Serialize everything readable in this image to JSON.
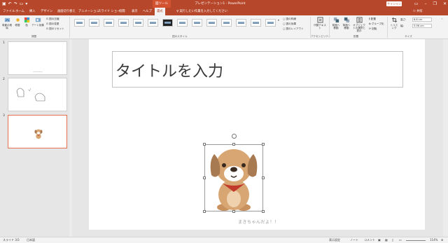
{
  "titlebar": {
    "context_tab": "図ツール",
    "document_title": "プレゼンテーション1 - PowerPoint",
    "signin": "サインイン"
  },
  "tabs": [
    "ファイル",
    "ホーム",
    "挿入",
    "デザイン",
    "画面切り替え",
    "アニメーション",
    "スライド ショー",
    "校閲",
    "表示",
    "ヘルプ",
    "書式"
  ],
  "tellme": "実行したい作業を入力してください",
  "share": "共有",
  "ribbon": {
    "adjust": {
      "label": "調整",
      "remove_bg": "背景の削除",
      "corrections": "修整",
      "color": "色",
      "art_effects": "アート効果",
      "compress": "図の圧縮",
      "change": "図の変更",
      "reset": "図のリセット"
    },
    "styles": {
      "label": "図のスタイル"
    },
    "style_options": {
      "border": "図の枠線",
      "effects": "図の効果",
      "layout": "図のレイアウト"
    },
    "accessibility": {
      "label": "アクセシビリティ",
      "alt_text": "代替テキスト"
    },
    "arrange": {
      "label": "配置",
      "forward": "前面へ移動",
      "backward": "背面へ移動",
      "selection_pane": "オブジェクトの選択と表示",
      "align": "配置",
      "group": "グループ化",
      "rotate": "回転"
    },
    "size": {
      "label": "サイズ",
      "crop": "トリミング",
      "height_label": "高さ:",
      "height_value": "6.8 cm",
      "width_label": "幅:",
      "width_value": "5.96 cm"
    }
  },
  "slides_panel": {
    "numbers": [
      "1",
      "2",
      "3"
    ]
  },
  "slide": {
    "title_placeholder": "タイトルを入力",
    "caption": "まきちゃんだよ！！"
  },
  "status": {
    "slide_count": "スライド 3/3",
    "language": "日本語",
    "accessibility": "表示設定",
    "notes": "ノート",
    "comments": "コメント",
    "zoom": "114%"
  },
  "colors": {
    "accent": "#b7472a",
    "dog_fur": "#d8a673",
    "dog_ears": "#a87a52",
    "collar": "#c0392b"
  }
}
